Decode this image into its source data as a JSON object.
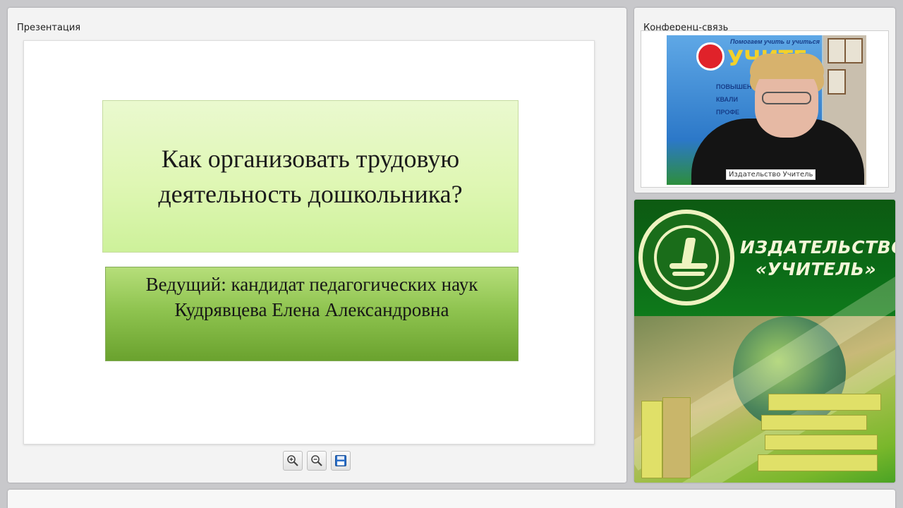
{
  "presentation": {
    "panel_title": "Презентация",
    "slide": {
      "title": "Как организовать трудовую деятельность дошкольника?",
      "presenter": "Ведущий: кандидат педагогических наук Кудрявцева Елена Александровна"
    },
    "toolbar": [
      {
        "name": "zoom-in-button",
        "icon": "zoom-in-icon"
      },
      {
        "name": "zoom-out-button",
        "icon": "zoom-out-icon"
      },
      {
        "name": "save-button",
        "icon": "floppy-disk-icon"
      }
    ]
  },
  "conference": {
    "panel_title": "Конференц-связь",
    "video": {
      "participant_name": "Издательство Учитель",
      "background_banner": {
        "tagline": "Помогаем учить и учиться",
        "brand": "УЧИТЕ",
        "items": [
          "ПОВЫШЕН",
          "КВАЛИ",
          "ПРОФЕ"
        ]
      }
    }
  },
  "ad": {
    "brand_line1": "ИЗДАТЕЛЬСТВО",
    "brand_line2": "«УЧИТЕЛЬ»"
  },
  "colors": {
    "title_box": "#dff7b4",
    "presenter_box": "#8fc450",
    "ad_green": "#0b6b17"
  }
}
